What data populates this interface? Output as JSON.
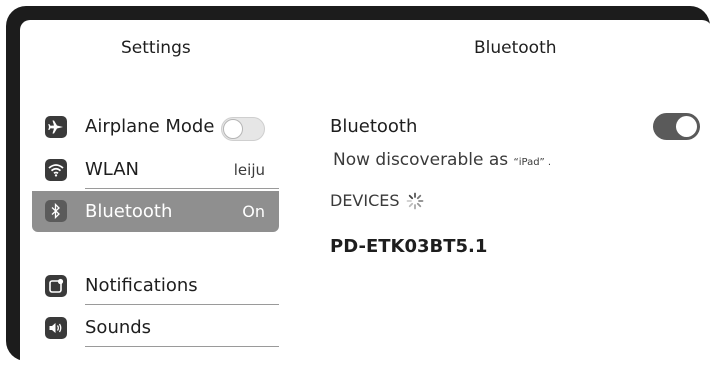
{
  "header": {
    "settings_title": "Settings",
    "detail_title": "Bluetooth"
  },
  "sidebar": {
    "items": [
      {
        "label": "Airplane Mode",
        "icon": "airplane-icon",
        "toggle": "off"
      },
      {
        "label": "WLAN",
        "value": "leiju",
        "icon": "wifi-icon"
      },
      {
        "label": "Bluetooth",
        "value": "On",
        "icon": "bluetooth-icon",
        "selected": true
      },
      {
        "label": "Notifications",
        "icon": "notifications-icon"
      },
      {
        "label": "Sounds",
        "icon": "sounds-icon"
      }
    ]
  },
  "detail": {
    "bluetooth_label": "Bluetooth",
    "bluetooth_toggle": "on",
    "discoverable_text": "Now discoverable as ",
    "discoverable_name": "“iPad” .",
    "devices_header": "DEVICES",
    "devices": [
      {
        "name": "PD-ETK03BT5.1"
      }
    ]
  },
  "colors": {
    "bezel": "#1c1c1c",
    "selected_row": "#8f8f8f",
    "icon_bg": "#3a3a3a",
    "toggle_on": "#5a5a5a"
  }
}
